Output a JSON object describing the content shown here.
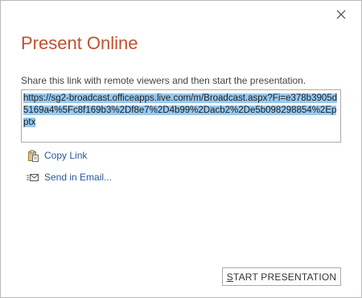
{
  "dialog": {
    "title": "Present Online",
    "close_icon": "close-icon",
    "instruction": "Share this link with remote viewers and then start the presentation.",
    "link": "https://sg2-broadcast.officeapps.live.com/m/Broadcast.aspx?Fi=e378b3905d5169a4%5Fc8f169b3%2Df8e7%2D4b99%2Dacb2%2De5b098298854%2Epptx",
    "copy_link_label": "Copy Link",
    "copy_link_icon": "clipboard-icon",
    "send_email_label": "Send in Email...",
    "send_email_icon": "email-icon",
    "start_button": {
      "mnemonic": "S",
      "rest": "TART PRESENTATION"
    },
    "colors": {
      "title": "#c1502e",
      "link_action": "#2b579a",
      "selection": "#99c9ef"
    }
  }
}
